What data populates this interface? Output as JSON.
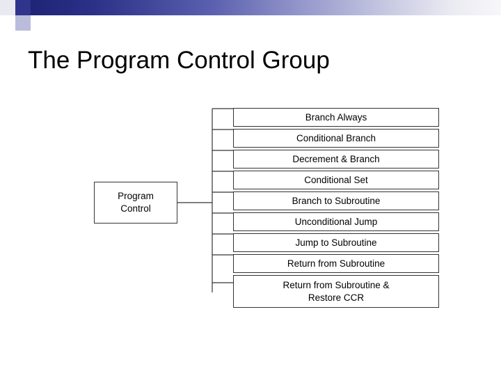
{
  "slide": {
    "title": "The Program Control Group"
  },
  "diagram": {
    "root": {
      "label_line1": "Program",
      "label_line2": "Control"
    },
    "leaves": [
      {
        "label": "Branch Always"
      },
      {
        "label": "Conditional Branch"
      },
      {
        "label": "Decrement & Branch"
      },
      {
        "label": "Conditional Set"
      },
      {
        "label": "Branch to Subroutine"
      },
      {
        "label": "Unconditional Jump"
      },
      {
        "label": "Jump to Subroutine"
      },
      {
        "label": "Return from Subroutine"
      },
      {
        "label_line1": "Return from Subroutine &",
        "label_line2": "Restore CCR"
      }
    ],
    "colors": {
      "box_border": "#333333",
      "box_fill": "#ffffff",
      "text": "#000000",
      "band_dark": "#1b1f6e",
      "band_light": "#f7f7fa"
    }
  }
}
